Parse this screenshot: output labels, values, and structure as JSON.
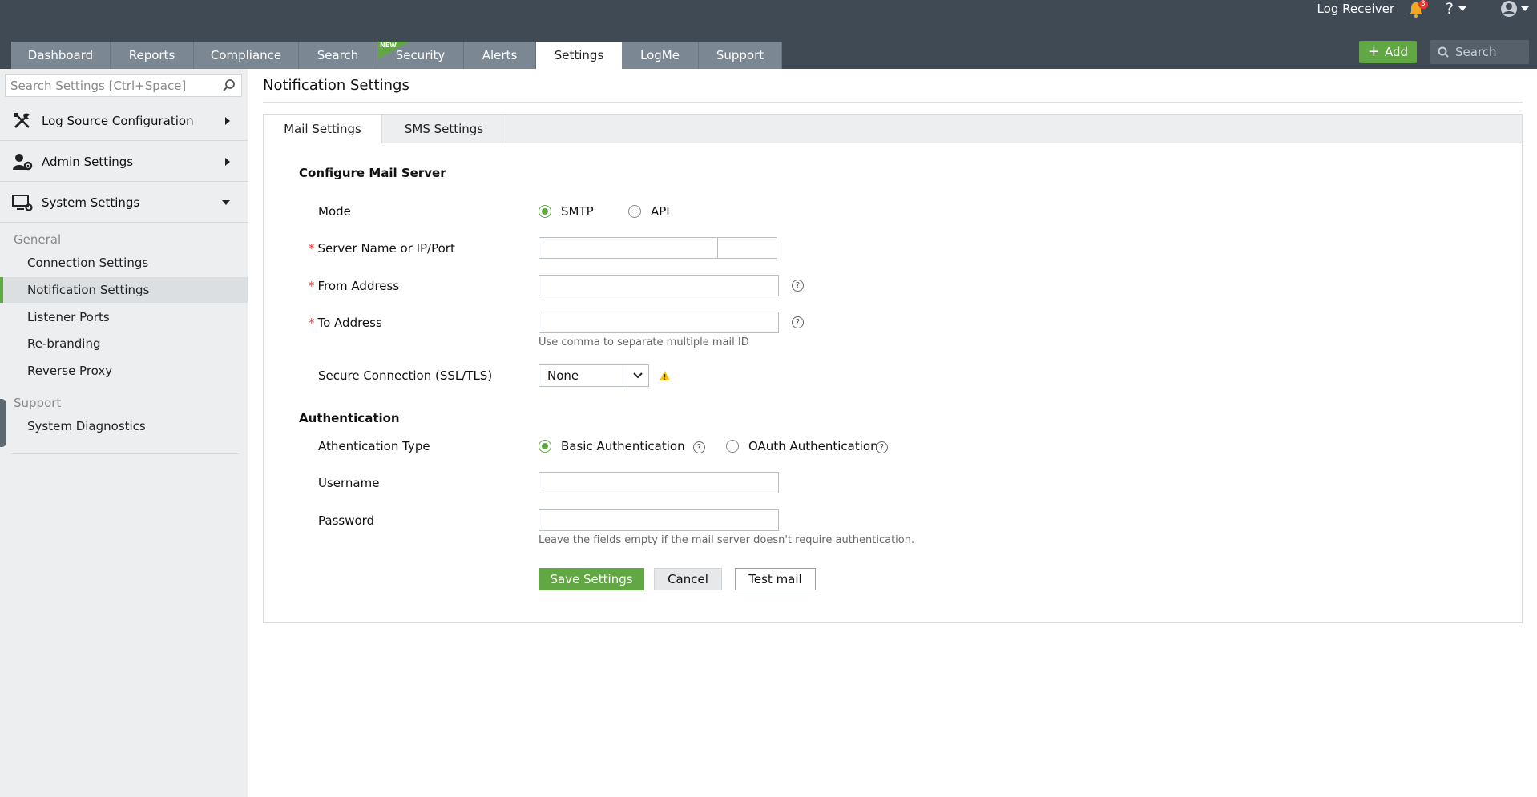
{
  "header": {
    "app_name": "Log Receiver",
    "notifications_count": "3",
    "help_label": "?",
    "add_label": "Add",
    "search_placeholder": "Search",
    "new_badge": "NEW"
  },
  "tabs": [
    {
      "label": "Dashboard"
    },
    {
      "label": "Reports"
    },
    {
      "label": "Compliance"
    },
    {
      "label": "Search"
    },
    {
      "label": "Security"
    },
    {
      "label": "Alerts"
    },
    {
      "label": "Settings"
    },
    {
      "label": "LogMe"
    },
    {
      "label": "Support"
    }
  ],
  "sidebar": {
    "search_placeholder": "Search Settings [Ctrl+Space]",
    "sections": [
      {
        "label": "Log Source Configuration"
      },
      {
        "label": "Admin Settings"
      },
      {
        "label": "System Settings"
      }
    ],
    "groups": [
      {
        "label": "General",
        "items": [
          "Connection Settings",
          "Notification Settings",
          "Listener Ports",
          "Re-branding",
          "Reverse Proxy"
        ]
      },
      {
        "label": "Support",
        "items": [
          "System Diagnostics"
        ]
      }
    ]
  },
  "page": {
    "title": "Notification Settings",
    "subtabs": [
      "Mail Settings",
      "SMS Settings"
    ],
    "mail": {
      "section_title": "Configure Mail Server",
      "mode_label": "Mode",
      "mode_options": [
        "SMTP",
        "API"
      ],
      "mode_selected": "SMTP",
      "server_label": "Server Name or IP/Port",
      "from_label": "From Address",
      "to_label": "To Address",
      "to_hint": "Use comma to separate multiple mail ID",
      "secure_label": "Secure Connection (SSL/TLS)",
      "secure_value": "None",
      "required_mark": "*"
    },
    "auth": {
      "section_title": "Authentication",
      "type_label": "Athentication Type",
      "type_options": [
        "Basic Authentication",
        "OAuth Authentication"
      ],
      "type_selected": "Basic Authentication",
      "username_label": "Username",
      "password_label": "Password",
      "hint": "Leave the fields empty if the mail server doesn't require authentication."
    },
    "buttons": {
      "save": "Save Settings",
      "cancel": "Cancel",
      "test": "Test mail"
    }
  },
  "colors": {
    "topbar": "#3f4a54",
    "tab": "#7b8792",
    "accent": "#61a844",
    "required": "#e53935",
    "warning": "#f5c518"
  }
}
